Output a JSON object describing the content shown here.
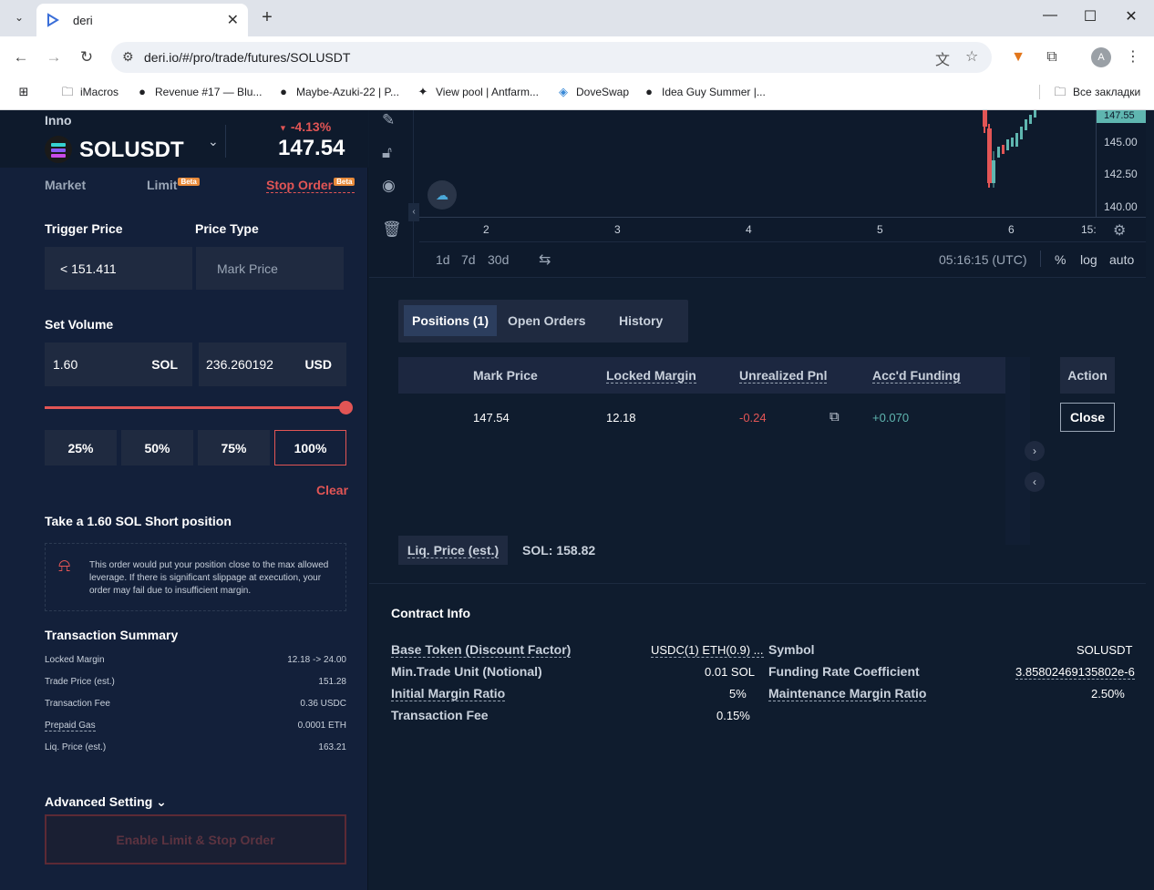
{
  "browser": {
    "tab_title": "deri",
    "url": "deri.io/#/pro/trade/futures/SOLUSDT",
    "bookmarks": [
      "iMacros",
      "Revenue #17 — Blu...",
      "Maybe-Azuki-22 | P...",
      "View pool | Antfarm...",
      "DoveSwap",
      "Idea Guy Summer |..."
    ],
    "all_bookmarks": "Все закладки",
    "avatar": "A"
  },
  "header": {
    "account": "Inno",
    "symbol": "SOLUSDT",
    "change": "-4.13%",
    "price": "147.54"
  },
  "order_tabs": {
    "market": "Market",
    "limit": "Limit",
    "stop": "Stop Order",
    "beta": "Beta"
  },
  "form": {
    "trigger_label": "Trigger Price",
    "type_label": "Price Type",
    "trigger_value": "< 151.411",
    "type_value": "Mark Price",
    "volume_label": "Set Volume",
    "sol_value": "1.60",
    "sol_unit": "SOL",
    "usd_value": "236.260192",
    "usd_unit": "USD",
    "slider_level": 1.0,
    "percents": [
      "25%",
      "50%",
      "75%",
      "100%"
    ],
    "clear": "Clear",
    "take": "Take a 1.60 SOL Short position",
    "warning": "This order would put your position close to the max allowed leverage. If there is significant slippage at execution, your order may fail due to insufficient margin."
  },
  "summary": {
    "title": "Transaction Summary",
    "rows": [
      {
        "k": "Locked Margin",
        "v": "12.18 -> 24.00"
      },
      {
        "k": "Trade Price (est.)",
        "v": "151.28"
      },
      {
        "k": "Transaction Fee",
        "v": "0.36 USDC"
      },
      {
        "k": "Prepaid Gas",
        "v": "0.0001 ETH"
      },
      {
        "k": "Liq. Price (est.)",
        "v": "163.21"
      }
    ],
    "advanced": "Advanced Setting",
    "enable": "Enable Limit & Stop Order"
  },
  "chart": {
    "y_ticks": [
      "147.55",
      "145.00",
      "142.50",
      "140.00"
    ],
    "x_ticks": [
      "2",
      "3",
      "4",
      "5",
      "6",
      "15:"
    ],
    "ranges": [
      "1d",
      "7d",
      "30d"
    ],
    "time": "05:16:15 (UTC)",
    "opts": [
      "%",
      "log",
      "auto"
    ]
  },
  "positions": {
    "tabs": [
      "Positions (1)",
      "Open Orders",
      "History"
    ],
    "headers": [
      "Mark Price",
      "Locked Margin",
      "Unrealized Pnl",
      "Acc'd Funding"
    ],
    "row": {
      "mark": "147.54",
      "margin": "12.18",
      "pnl": "-0.24",
      "funding": "+0.070"
    },
    "action": "Action",
    "close": "Close",
    "liq_label": "Liq. Price (est.)",
    "liq_value": "SOL: 158.82"
  },
  "contract": {
    "title": "Contract Info",
    "left": [
      {
        "k": "Base Token (Discount Factor)",
        "v": "USDC(1) ETH(0.9) ..."
      },
      {
        "k": "Min.Trade Unit (Notional)",
        "v": "0.01 SOL"
      },
      {
        "k": "Initial Margin Ratio",
        "v": "5%"
      },
      {
        "k": "Transaction Fee",
        "v": "0.15%"
      }
    ],
    "right": [
      {
        "k": "Symbol",
        "v": "SOLUSDT"
      },
      {
        "k": "Funding Rate Coefficient",
        "v": "3.85802469135802e-6"
      },
      {
        "k": "Maintenance Margin Ratio",
        "v": "2.50%"
      }
    ]
  },
  "colors": {
    "accent": "#e25555",
    "positive": "#5fb6b0",
    "panel": "#13203a"
  }
}
